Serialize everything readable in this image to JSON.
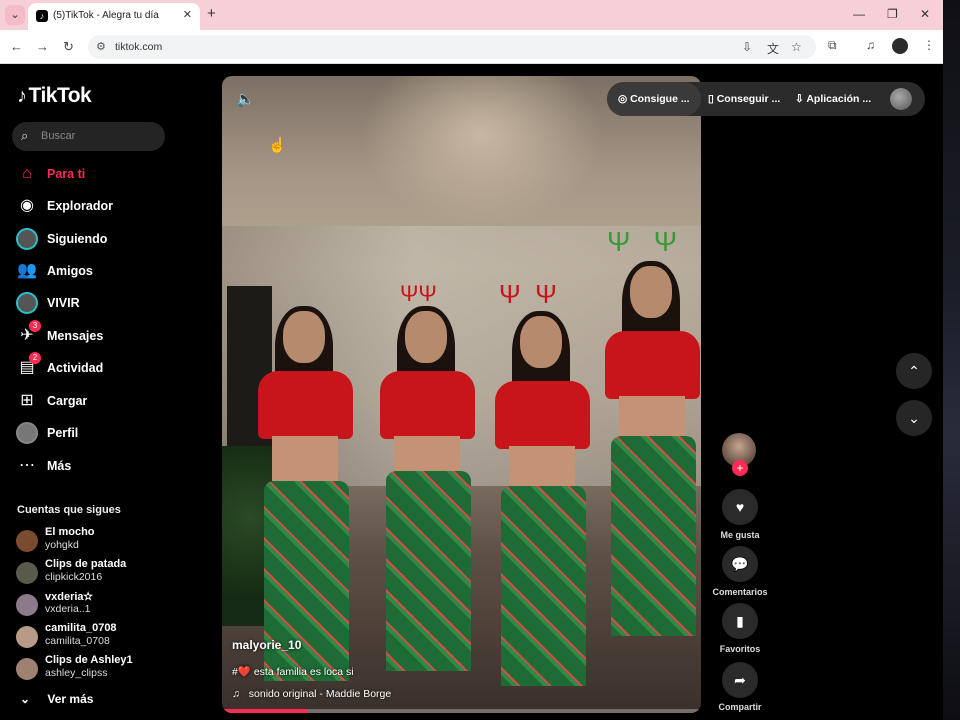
{
  "browser": {
    "tab_title": "(5)TikTok - Alegra tu día",
    "url": "tiktok.com",
    "tab_menu_icon": "chevron-down-icon",
    "new_tab_glyph": "+",
    "close_glyph": "✕"
  },
  "brand": {
    "name": "TikTok",
    "accent": "#fe2c55"
  },
  "search": {
    "placeholder": "Buscar"
  },
  "nav": [
    {
      "label": "Para ti",
      "icon": "home-icon",
      "active": true
    },
    {
      "label": "Explorador",
      "icon": "compass-icon"
    },
    {
      "label": "Siguiendo",
      "icon": "following-avatar-icon"
    },
    {
      "label": "Amigos",
      "icon": "friends-icon"
    },
    {
      "label": "VIVIR",
      "icon": "live-avatar-icon"
    },
    {
      "label": "Mensajes",
      "icon": "messages-icon",
      "badge": "3"
    },
    {
      "label": "Actividad",
      "icon": "activity-icon",
      "badge": "2"
    },
    {
      "label": "Cargar",
      "icon": "upload-icon"
    },
    {
      "label": "Perfil",
      "icon": "profile-avatar-icon"
    },
    {
      "label": "Más",
      "icon": "more-icon"
    }
  ],
  "following": {
    "title": "Cuentas que sigues",
    "accounts": [
      {
        "name": "El mocho",
        "handle": "yohgkd"
      },
      {
        "name": "Clips de patada",
        "handle": "clipkick2016"
      },
      {
        "name": "vxderia✫",
        "handle": "vxderia..1"
      },
      {
        "name": "camilita_0708",
        "handle": "camilita_0708"
      },
      {
        "name": "Clips de Ashley1",
        "handle": "ashley_clipss"
      }
    ],
    "see_more": "Ver más"
  },
  "video": {
    "author": "malyorie_10",
    "caption": "#❤️ esta familia es loca si",
    "music": "sonido original - Maddie Borge",
    "progress": 0.18
  },
  "top_pill": {
    "items": [
      "Consigue ...",
      "Conseguir ...",
      "Aplicación ..."
    ]
  },
  "actions": {
    "like": "Me gusta",
    "comments": "Comentarios",
    "favorites": "Favoritos",
    "share": "Compartir"
  }
}
